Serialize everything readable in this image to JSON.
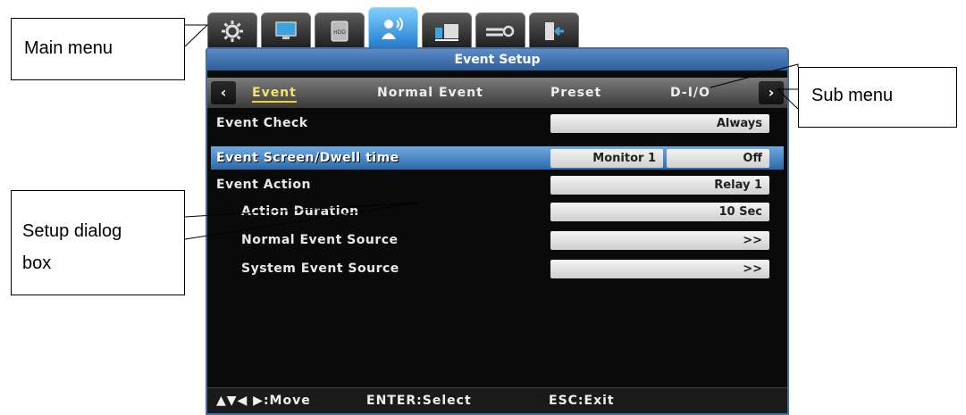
{
  "callouts": {
    "main_menu": "Main menu",
    "sub_menu": "Sub menu",
    "setup_line1": "Setup dialog",
    "setup_line2": "box"
  },
  "main_tabs": [
    {
      "icon": "gear-icon",
      "active": false
    },
    {
      "icon": "monitor-icon",
      "active": false
    },
    {
      "icon": "hdd-icon",
      "label": "HDD",
      "active": false
    },
    {
      "icon": "event-person-icon",
      "active": true
    },
    {
      "icon": "network-icon",
      "active": false
    },
    {
      "icon": "system-settings-icon",
      "active": false
    },
    {
      "icon": "exit-icon",
      "active": false
    }
  ],
  "dialog": {
    "title": "Event Setup",
    "sub_tabs": [
      {
        "label": "Event",
        "active": true
      },
      {
        "label": "Normal Event",
        "active": false
      },
      {
        "label": "Preset",
        "active": false
      },
      {
        "label": "D-I/O",
        "active": false
      }
    ],
    "rows": [
      {
        "label": "Event Check",
        "value": "Always"
      },
      {
        "label": "Event Screen/Dwell time",
        "value1": "Monitor 1",
        "value2": "Off",
        "highlight": true
      },
      {
        "label": "Event Action",
        "value": "Relay 1"
      },
      {
        "label": "Action Duration",
        "value": "10 Sec"
      },
      {
        "label": "Normal Event Source",
        "value": ">>"
      },
      {
        "label": "System Event Source",
        "value": ">>"
      }
    ],
    "status": {
      "move": "▲▼◀ ▶:Move",
      "select": "ENTER:Select",
      "exit": "ESC:Exit"
    }
  },
  "colors": {
    "title_bar": "#3f73b0",
    "highlight_row": "#4a8bcc",
    "active_tab_underline": "#f2d22c"
  }
}
